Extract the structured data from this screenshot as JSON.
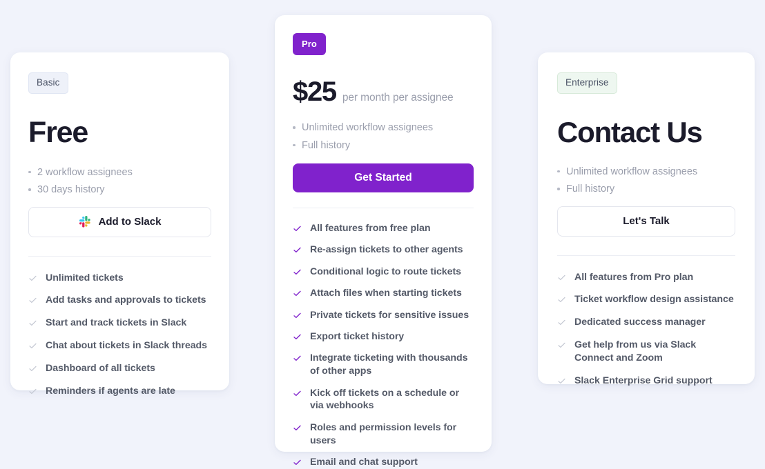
{
  "colors": {
    "page_background": "#f1f3fb",
    "card_background": "#ffffff",
    "pro_accent": "#8022cc",
    "basic_badge_bg": "#eef1f9",
    "enterprise_badge_bg": "#eef7f0",
    "heading_text": "#1b1b2b",
    "muted_text": "#9a9eac",
    "feature_text": "#545a68",
    "basic_check": "#c3c7d2",
    "enterprise_check": "#c3c7d2"
  },
  "plans": [
    {
      "id": "basic",
      "badge": "Basic",
      "headline": "Free",
      "bullets": [
        "2 workflow assignees",
        "30 days history"
      ],
      "cta": {
        "label": "Add to Slack",
        "style": "outline",
        "icon": "slack-logo-icon"
      },
      "features": [
        "Unlimited tickets",
        "Add tasks and approvals to tickets",
        "Start and track tickets in Slack",
        "Chat about tickets in Slack threads",
        "Dashboard of all tickets",
        "Reminders if agents are late"
      ]
    },
    {
      "id": "pro",
      "badge": "Pro",
      "price_amount": "$25",
      "price_period": "per month per assignee",
      "bullets": [
        "Unlimited workflow assignees",
        "Full history"
      ],
      "cta": {
        "label": "Get Started",
        "style": "primary",
        "icon": ""
      },
      "features": [
        "All features from free plan",
        "Re-assign tickets to other agents",
        "Conditional logic to route tickets",
        "Attach files when starting tickets",
        "Private tickets for sensitive issues",
        "Export ticket history",
        "Integrate ticketing with thousands of other apps",
        "Kick off tickets on a schedule or via webhooks",
        "Roles and permission levels for users",
        "Email and chat support"
      ]
    },
    {
      "id": "enterprise",
      "badge": "Enterprise",
      "headline": "Contact Us",
      "bullets": [
        "Unlimited workflow assignees",
        "Full history"
      ],
      "cta": {
        "label": "Let's Talk",
        "style": "outline",
        "icon": ""
      },
      "features": [
        "All features from Pro plan",
        "Ticket workflow design assistance",
        "Dedicated success manager",
        "Get help from us via Slack Connect and Zoom",
        "Slack Enterprise Grid support"
      ]
    }
  ]
}
